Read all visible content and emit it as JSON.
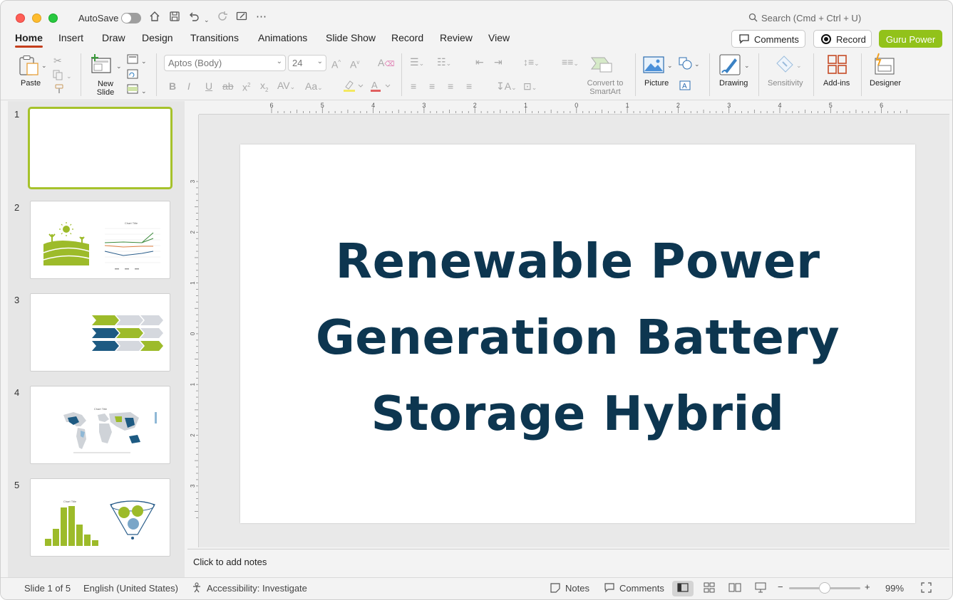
{
  "titlebar": {
    "autosave_label": "AutoSave",
    "search_placeholder": "Search (Cmd + Ctrl + U)"
  },
  "tabs": [
    {
      "label": "Home",
      "active": true
    },
    {
      "label": "Insert"
    },
    {
      "label": "Draw"
    },
    {
      "label": "Design"
    },
    {
      "label": "Transitions"
    },
    {
      "label": "Animations"
    },
    {
      "label": "Slide Show"
    },
    {
      "label": "Record"
    },
    {
      "label": "Review"
    },
    {
      "label": "View"
    }
  ],
  "header_buttons": {
    "comments": "Comments",
    "record": "Record",
    "guru": "Guru Power",
    "guru_color": "#92c21a"
  },
  "ribbon": {
    "paste": "Paste",
    "new_slide": "New Slide",
    "font_name": "Aptos (Body)",
    "font_size": "24",
    "convert_smartart": "Convert to SmartArt",
    "picture": "Picture",
    "drawing": "Drawing",
    "sensitivity": "Sensitivity",
    "addins": "Add-ins",
    "designer": "Designer"
  },
  "slides": [
    {
      "number": "1"
    },
    {
      "number": "2"
    },
    {
      "number": "3"
    },
    {
      "number": "4"
    },
    {
      "number": "5"
    }
  ],
  "slide": {
    "title_line1": "Renewable Power",
    "title_line2": "Generation Battery",
    "title_line3": "Storage Hybrid",
    "title_color": "#0d3650"
  },
  "ruler": {
    "horizontal_labels": [
      "6",
      "5",
      "4",
      "3",
      "2",
      "1",
      "0",
      "1",
      "2",
      "3",
      "4",
      "5",
      "6"
    ],
    "vertical_labels": [
      "3",
      "2",
      "1",
      "0",
      "1",
      "2",
      "3"
    ]
  },
  "notes": {
    "placeholder": "Click to add notes"
  },
  "status": {
    "slide_count": "Slide 1 of 5",
    "language": "English (United States)",
    "accessibility": "Accessibility: Investigate",
    "notes_label": "Notes",
    "comments_label": "Comments",
    "zoom_percent": "99%"
  },
  "accent": "#a6c22b"
}
